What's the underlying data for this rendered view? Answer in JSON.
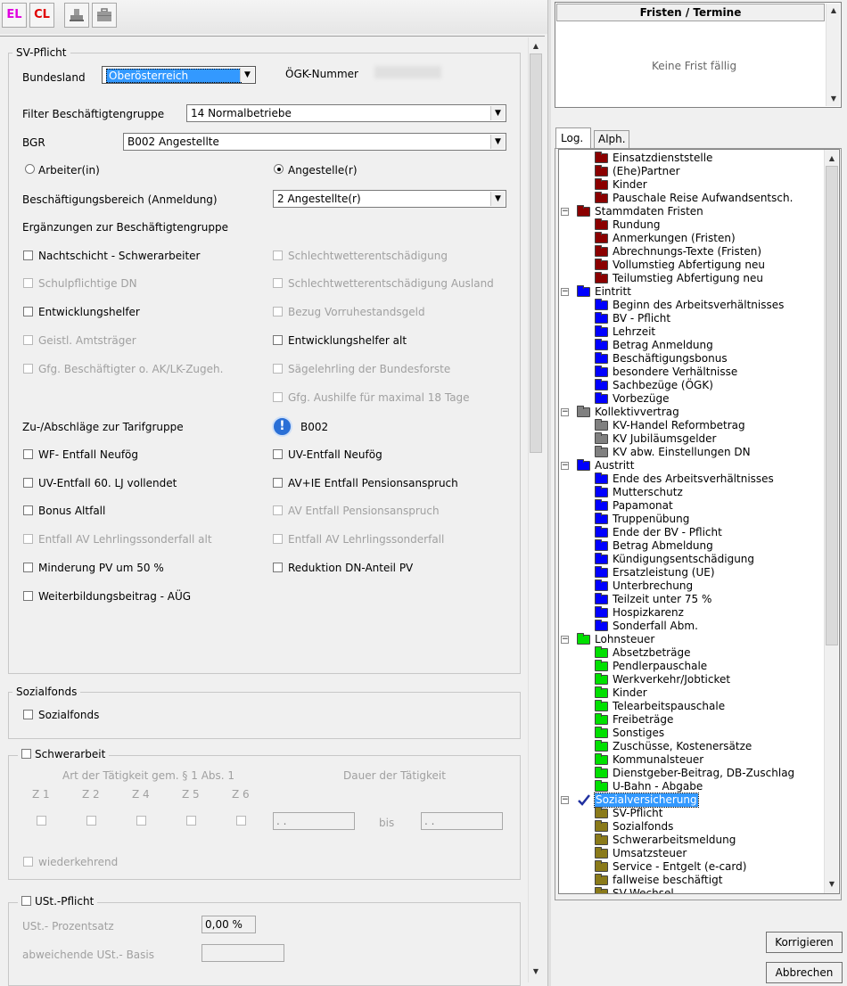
{
  "toolbar": {
    "el_label": "EL",
    "cl_label": "CL"
  },
  "sv": {
    "legend": "SV-Pflicht",
    "bundesland_label": "Bundesland",
    "bundesland_value": "Oberösterreich",
    "oegk_label": "ÖGK-Nummer",
    "filter_label": "Filter Beschäftigtengruppe",
    "filter_value": "14   Normalbetriebe",
    "bgr_label": "BGR",
    "bgr_value": "B002     Angestellte",
    "arbeiter_label": "Arbeiter(in)",
    "angestellte_label": "Angestelle(r)",
    "bereich_label": "Beschäftigungsbereich (Anmeldung)",
    "bereich_value": "2   Angestellte(r)",
    "erg_label": "Ergänzungen zur Beschäftigtengruppe",
    "erg_left": [
      {
        "label": "Nachtschicht - Schwerarbeiter",
        "disabled": false
      },
      {
        "label": "Schulpflichtige DN",
        "disabled": true
      },
      {
        "label": "Entwicklungshelfer",
        "disabled": false
      },
      {
        "label": "Geistl. Amtsträger",
        "disabled": true
      },
      {
        "label": "Gfg. Beschäftigter o. AK/LK-Zugeh.",
        "disabled": true
      }
    ],
    "erg_right": [
      {
        "label": "Schlechtwetterentschädigung",
        "disabled": true
      },
      {
        "label": "Schlechtwetterentschädigung Ausland",
        "disabled": true
      },
      {
        "label": "Bezug Vorruhestandsgeld",
        "disabled": true
      },
      {
        "label": "Entwicklungshelfer alt",
        "disabled": false
      },
      {
        "label": "Sägelehrling der Bundesforste",
        "disabled": true
      },
      {
        "label": "Gfg. Aushilfe für maximal 18 Tage",
        "disabled": true
      }
    ],
    "zu_label": "Zu-/Abschläge zur Tarifgruppe",
    "zu_value": "B002",
    "zu_left": [
      {
        "label": "WF- Entfall Neufög",
        "disabled": false
      },
      {
        "label": "UV-Entfall 60. LJ vollendet",
        "disabled": false
      },
      {
        "label": "Bonus Altfall",
        "disabled": false
      },
      {
        "label": "Entfall AV Lehrlingssonderfall alt",
        "disabled": true
      },
      {
        "label": "Minderung PV um 50 %",
        "disabled": false
      },
      {
        "label": "Weiterbildungsbeitrag - AÜG",
        "disabled": false
      }
    ],
    "zu_right": [
      {
        "label": "UV-Entfall Neufög",
        "disabled": false
      },
      {
        "label": "AV+IE Entfall Pensionsanspruch",
        "disabled": false
      },
      {
        "label": "AV Entfall Pensionsanspruch",
        "disabled": true
      },
      {
        "label": "Entfall AV Lehrlingssonderfall",
        "disabled": true
      },
      {
        "label": "Reduktion DN-Anteil PV",
        "disabled": false
      }
    ]
  },
  "sozialfonds": {
    "legend": "Sozialfonds",
    "checkbox_label": "Sozialfonds"
  },
  "schwerarbeit": {
    "legend": "Schwerarbeit",
    "art_label": "Art der Tätigkeit gem. § 1 Abs. 1",
    "dauer_label": "Dauer der Tätigkeit",
    "zs": [
      "Z 1",
      "Z 2",
      "Z 4",
      "Z 5",
      "Z 6"
    ],
    "from_value": " .  .",
    "bis_label": "bis",
    "to_value": " .  .",
    "wiederkehrend_label": "wiederkehrend"
  },
  "ust": {
    "legend": "USt.-Pflicht",
    "prozent_label": "USt.- Prozentsatz",
    "prozent_value": "0,00  %",
    "basis_label": "abweichende USt.- Basis",
    "basis_value": ""
  },
  "fristen": {
    "title": "Fristen / Termine",
    "empty_text": "Keine Frist fällig"
  },
  "tabs": [
    "Log.",
    "Alph."
  ],
  "colors": {
    "red": "#8b0000",
    "blue": "#0000ff",
    "gray": "#808080",
    "green": "#00e000",
    "olive": "#8a7a1a"
  },
  "tree": [
    {
      "label": "Einsatzdienststelle",
      "level": 1,
      "color": "red"
    },
    {
      "label": "(Ehe)Partner",
      "level": 1,
      "color": "red"
    },
    {
      "label": "Kinder",
      "level": 1,
      "color": "red"
    },
    {
      "label": "Pauschale Reise Aufwandsentsch.",
      "level": 1,
      "color": "red"
    },
    {
      "label": "Stammdaten Fristen",
      "level": 0,
      "color": "red"
    },
    {
      "label": "Rundung",
      "level": 1,
      "color": "red"
    },
    {
      "label": "Anmerkungen (Fristen)",
      "level": 1,
      "color": "red"
    },
    {
      "label": "Abrechnungs-Texte (Fristen)",
      "level": 1,
      "color": "red"
    },
    {
      "label": "Vollumstieg Abfertigung neu",
      "level": 1,
      "color": "red"
    },
    {
      "label": "Teilumstieg Abfertigung neu",
      "level": 1,
      "color": "red"
    },
    {
      "label": "Eintritt",
      "level": 0,
      "color": "blue"
    },
    {
      "label": "Beginn des Arbeitsverhältnisses",
      "level": 1,
      "color": "blue"
    },
    {
      "label": "BV - Pflicht",
      "level": 1,
      "color": "blue"
    },
    {
      "label": "Lehrzeit",
      "level": 1,
      "color": "blue"
    },
    {
      "label": "Betrag Anmeldung",
      "level": 1,
      "color": "blue"
    },
    {
      "label": "Beschäftigungsbonus",
      "level": 1,
      "color": "blue"
    },
    {
      "label": "besondere Verhältnisse",
      "level": 1,
      "color": "blue"
    },
    {
      "label": "Sachbezüge (ÖGK)",
      "level": 1,
      "color": "blue"
    },
    {
      "label": "Vorbezüge",
      "level": 1,
      "color": "blue"
    },
    {
      "label": "Kollektivvertrag",
      "level": 0,
      "color": "gray"
    },
    {
      "label": "KV-Handel Reformbetrag",
      "level": 1,
      "color": "gray"
    },
    {
      "label": "KV Jubiläumsgelder",
      "level": 1,
      "color": "gray"
    },
    {
      "label": "KV abw. Einstellungen DN",
      "level": 1,
      "color": "gray"
    },
    {
      "label": "Austritt",
      "level": 0,
      "color": "blue"
    },
    {
      "label": "Ende des Arbeitsverhältnisses",
      "level": 1,
      "color": "blue"
    },
    {
      "label": "Mutterschutz",
      "level": 1,
      "color": "blue"
    },
    {
      "label": "Papamonat",
      "level": 1,
      "color": "blue"
    },
    {
      "label": "Truppenübung",
      "level": 1,
      "color": "blue"
    },
    {
      "label": "Ende der BV - Pflicht",
      "level": 1,
      "color": "blue"
    },
    {
      "label": "Betrag Abmeldung",
      "level": 1,
      "color": "blue"
    },
    {
      "label": "Kündigungsentschädigung",
      "level": 1,
      "color": "blue"
    },
    {
      "label": "Ersatzleistung (UE)",
      "level": 1,
      "color": "blue"
    },
    {
      "label": "Unterbrechung",
      "level": 1,
      "color": "blue"
    },
    {
      "label": "Teilzeit unter 75 %",
      "level": 1,
      "color": "blue"
    },
    {
      "label": "Hospizkarenz",
      "level": 1,
      "color": "blue"
    },
    {
      "label": "Sonderfall Abm.",
      "level": 1,
      "color": "blue"
    },
    {
      "label": "Lohnsteuer",
      "level": 0,
      "color": "green"
    },
    {
      "label": "Absetzbeträge",
      "level": 1,
      "color": "green"
    },
    {
      "label": "Pendlerpauschale",
      "level": 1,
      "color": "green"
    },
    {
      "label": "Werkverkehr/Jobticket",
      "level": 1,
      "color": "green"
    },
    {
      "label": "Kinder",
      "level": 1,
      "color": "green"
    },
    {
      "label": "Telearbeitspauschale",
      "level": 1,
      "color": "green"
    },
    {
      "label": "Freibeträge",
      "level": 1,
      "color": "green"
    },
    {
      "label": "Sonstiges",
      "level": 1,
      "color": "green"
    },
    {
      "label": "Zuschüsse, Kostenersätze",
      "level": 1,
      "color": "green"
    },
    {
      "label": "Kommunalsteuer",
      "level": 1,
      "color": "green"
    },
    {
      "label": "Dienstgeber-Beitrag, DB-Zuschlag",
      "level": 1,
      "color": "green"
    },
    {
      "label": "U-Bahn - Abgabe",
      "level": 1,
      "color": "green"
    },
    {
      "label": "Sozialversicherung",
      "level": 0,
      "color": "check",
      "selected": true
    },
    {
      "label": "SV-Pflicht",
      "level": 1,
      "color": "olive"
    },
    {
      "label": "Sozialfonds",
      "level": 1,
      "color": "olive"
    },
    {
      "label": "Schwerarbeitsmeldung",
      "level": 1,
      "color": "olive"
    },
    {
      "label": "Umsatzsteuer",
      "level": 1,
      "color": "olive"
    },
    {
      "label": "Service - Entgelt (e-card)",
      "level": 1,
      "color": "olive"
    },
    {
      "label": "fallweise beschäftigt",
      "level": 1,
      "color": "olive"
    },
    {
      "label": "SV-Wechsel",
      "level": 1,
      "color": "olive"
    }
  ],
  "buttons": {
    "korrigieren": "Korrigieren",
    "abbrechen": "Abbrechen"
  }
}
